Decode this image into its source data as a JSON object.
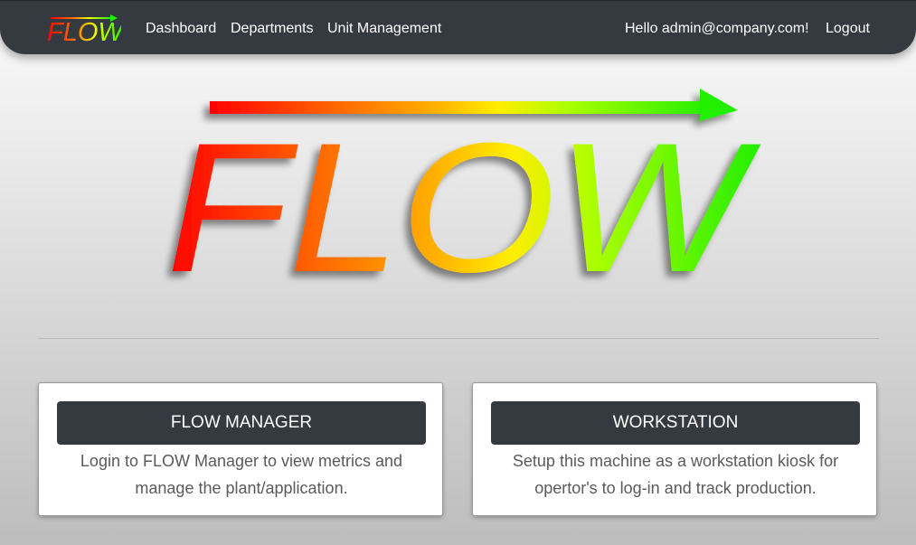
{
  "brand": {
    "logo_text": "FLOW",
    "colors": [
      "#ff0000",
      "#ff6a00",
      "#ffd000",
      "#c8ff00",
      "#22ee00"
    ]
  },
  "nav": {
    "items": [
      {
        "label": "Dashboard"
      },
      {
        "label": "Departments"
      },
      {
        "label": "Unit Management"
      }
    ],
    "greeting": "Hello admin@company.com!",
    "logout_label": "Logout",
    "background": "#343a40"
  },
  "hero": {
    "logo_text": "FLOW",
    "arrow_icon": "right-arrow-icon"
  },
  "cards": [
    {
      "button_label": "FLOW MANAGER",
      "description": "Login to FLOW Manager to view metrics and manage the plant/application."
    },
    {
      "button_label": "WORKSTATION",
      "description": "Setup this machine as a workstation kiosk for opertor's to log-in and track production."
    }
  ]
}
